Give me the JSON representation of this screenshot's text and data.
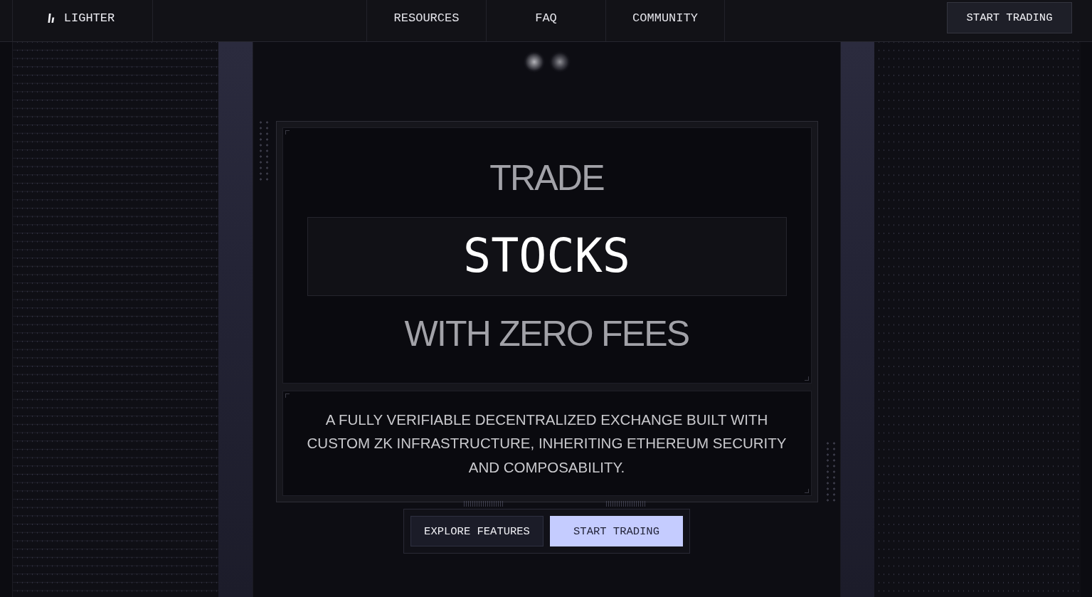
{
  "nav": {
    "logo": "LIGHTER",
    "links": [
      "RESOURCES",
      "FAQ",
      "COMMUNITY"
    ],
    "cta": "START TRADING"
  },
  "hero": {
    "line_1": "TRADE",
    "highlight": "STOCKS",
    "line_2": "WITH ZERO FEES",
    "description": "A FULLY VERIFIABLE DECENTRALIZED EXCHANGE BUILT WITH CUSTOM ZK INFRASTRUCTURE, INHERITING ETHEREUM SECURITY AND COMPOSABILITY.",
    "buttons": [
      {
        "label": "EXPLORE FEATURES",
        "kind": "secondary"
      },
      {
        "label": "START TRADING",
        "kind": "primary"
      }
    ]
  }
}
